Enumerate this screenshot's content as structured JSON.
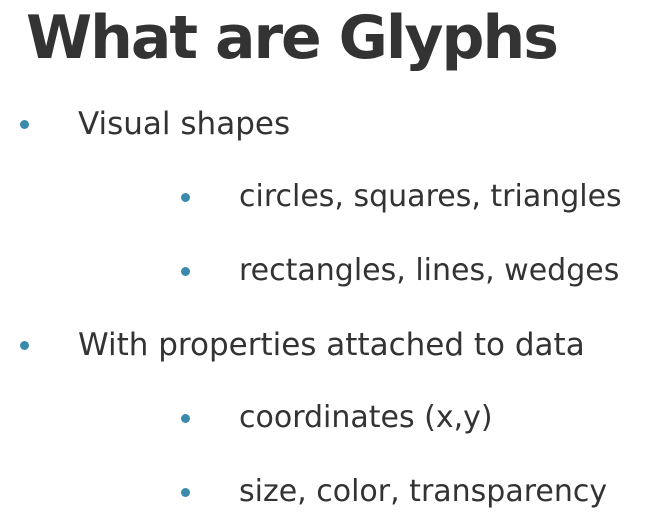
{
  "slide": {
    "title": "What are Glyphs",
    "bullet_color": "#3a8bab",
    "items": [
      {
        "level": 1,
        "text": "Visual shapes"
      },
      {
        "level": 2,
        "text": "circles, squares, triangles"
      },
      {
        "level": 2,
        "text": "rectangles, lines, wedges"
      },
      {
        "level": 1,
        "text": "With properties attached to data"
      },
      {
        "level": 2,
        "text": "coordinates (x,y)"
      },
      {
        "level": 2,
        "text": "size, color, transparency"
      }
    ]
  }
}
